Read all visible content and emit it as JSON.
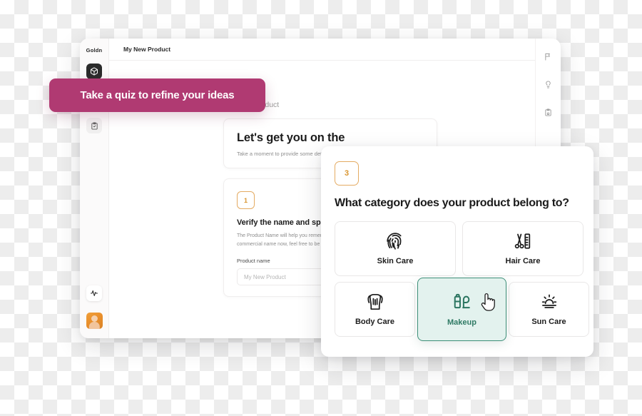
{
  "app": {
    "brand": "Goldn",
    "topbar_title": "My New Product",
    "left_rail_icons": [
      {
        "name": "box-icon",
        "state": "active"
      },
      {
        "name": "lightbulb-icon",
        "state": "default"
      },
      {
        "name": "clipboard-check-icon",
        "state": "tinted"
      },
      {
        "name": "activity-icon",
        "state": "card"
      }
    ],
    "right_rail_icons": [
      {
        "name": "flag-icon"
      },
      {
        "name": "lightbulb-icon"
      },
      {
        "name": "clipboard-icon"
      }
    ],
    "avatar_name": "user-avatar"
  },
  "main": {
    "kicker": "Create a product",
    "hero_title": "Let's get you on the",
    "hero_sub": "Take a moment to provide some details",
    "step": {
      "number": "1",
      "title": "Verify the name and spelling",
      "body": "The Product Name will help you remember. You do not have to decide its commercial name now, feel free to be creative!",
      "field_label": "Product name",
      "field_placeholder": "My New Product",
      "field_value": ""
    }
  },
  "callout": {
    "label": "Take a quiz to refine your ideas",
    "color": "#b03a72"
  },
  "quiz": {
    "step_number": "3",
    "question": "What category does your product belong to?",
    "selected_color": "#e3f2ee",
    "selected_border": "#3d8f78",
    "options": [
      {
        "label": "Skin Care",
        "icon": "fingerprint-icon",
        "selected": false
      },
      {
        "label": "Hair Care",
        "icon": "scissors-comb-icon",
        "selected": false
      },
      {
        "label": "Body Care",
        "icon": "torso-icon",
        "selected": false
      },
      {
        "label": "Makeup",
        "icon": "lipstick-icon",
        "selected": true
      },
      {
        "label": "Sun Care",
        "icon": "sun-icon",
        "selected": false
      }
    ],
    "cursor": "hand-pointer-cursor"
  }
}
